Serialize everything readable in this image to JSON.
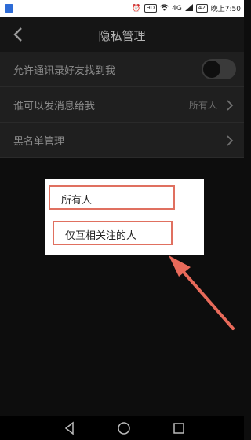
{
  "status_bar": {
    "time": "晚上7:50",
    "hd": "HD",
    "signal": "4G",
    "battery": "42"
  },
  "header": {
    "title": "隐私管理"
  },
  "settings": {
    "rows": [
      {
        "label": "允许通讯录好友找到我"
      },
      {
        "label": "谁可以发消息给我",
        "value": "所有人"
      },
      {
        "label": "黑名单管理"
      }
    ]
  },
  "popup": {
    "options": [
      {
        "label": "所有人"
      },
      {
        "label": "仅互相关注的人"
      }
    ]
  },
  "colors": {
    "accent_highlight": "#e07060",
    "background": "#0d0d0d"
  }
}
